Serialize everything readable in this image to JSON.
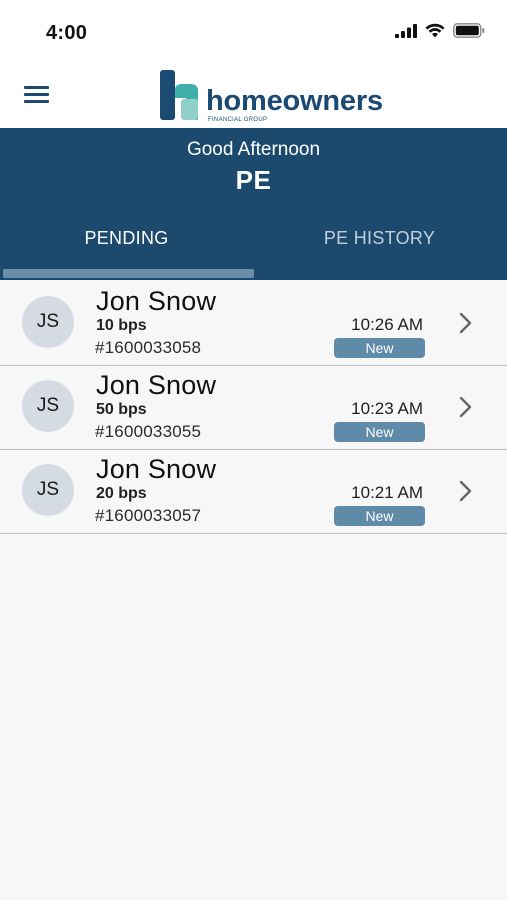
{
  "status_bar": {
    "time": "4:00",
    "icons": [
      "cellular-signal-icon",
      "wifi-icon",
      "battery-icon"
    ]
  },
  "header": {
    "menu_icon": "hamburger-menu-icon",
    "logo_text": "homeowners",
    "logo_subtext": "FINANCIAL GROUP"
  },
  "banner": {
    "greeting": "Good Afternoon",
    "user": "PE"
  },
  "tabs": [
    {
      "label": "PENDING",
      "active": true
    },
    {
      "label": "PE HISTORY",
      "active": false
    }
  ],
  "items": [
    {
      "initials": "JS",
      "name": "Jon Snow",
      "bps": "10 bps",
      "id": "#1600033058",
      "time": "10:26 AM",
      "status": "New"
    },
    {
      "initials": "JS",
      "name": "Jon Snow",
      "bps": "50 bps",
      "id": "#1600033055",
      "time": "10:23 AM",
      "status": "New"
    },
    {
      "initials": "JS",
      "name": "Jon Snow",
      "bps": "20 bps",
      "id": "#1600033057",
      "time": "10:21 AM",
      "status": "New"
    }
  ],
  "colors": {
    "brand_navy": "#1c4a6e",
    "tab_indicator": "#6b8ea8",
    "badge": "#5f8aa8",
    "logo_teal": "#3fb0a9",
    "logo_blue": "#1b4a72"
  }
}
